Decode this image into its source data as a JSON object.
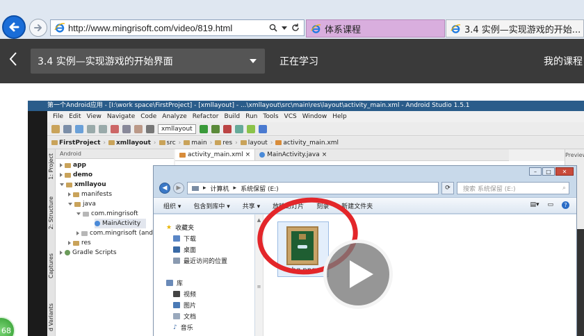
{
  "browser": {
    "url": "http://www.mingrisoft.com/video/819.html",
    "tabs": [
      {
        "label": "体系课程",
        "active": false
      },
      {
        "label": "3.4 实例—实现游戏的开始...",
        "active": true
      }
    ],
    "close_glyph": "×"
  },
  "site": {
    "course_select": "3.4  实例—实现游戏的开始界面",
    "learning_label": "正在学习",
    "my_course_label": "我的课程"
  },
  "video": {
    "as_window_title": "第一个Android应用 - [I:\\work space\\FirstProject] - [xmllayout] - ...\\xmllayout\\src\\main\\res\\layout\\activity_main.xml - Android Studio 1.5.1",
    "menu": [
      "File",
      "Edit",
      "View",
      "Navigate",
      "Code",
      "Analyze",
      "Refactor",
      "Build",
      "Run",
      "Tools",
      "VCS",
      "Window",
      "Help"
    ],
    "toolbar_combo": "xmllayout",
    "breadcrumb": [
      "FirstProject",
      "xmllayout",
      "src",
      "main",
      "res",
      "layout",
      "activity_main.xml"
    ],
    "side_tabs": [
      "1: Project",
      "2: Structure",
      "Captures",
      "d Variants"
    ],
    "project_header": "Android",
    "tree": [
      {
        "label": "app",
        "bold": true
      },
      {
        "label": "demo",
        "bold": true
      },
      {
        "label": "xmllayou",
        "bold": true
      },
      {
        "label": "manifests",
        "bold": false
      },
      {
        "label": "java",
        "bold": false
      },
      {
        "label": "com.mingrisoft",
        "bold": false
      },
      {
        "label": "MainActivity",
        "bold": false
      },
      {
        "label": "com.mingrisoft (and",
        "bold": false
      },
      {
        "label": "res",
        "bold": false
      },
      {
        "label": "Gradle Scripts",
        "bold": false
      }
    ],
    "editor_tabs": [
      "activity_main.xml",
      "MainActivity.java"
    ],
    "preview_label": "Preview",
    "explorer": {
      "path": [
        "计算机",
        "系统保留 (E:)"
      ],
      "search_placeholder": "搜索 系统保留 (E:)",
      "commands": [
        "组织 ▾",
        "包含到库中 ▾",
        "共享 ▾",
        "放映幻灯片",
        "刻录",
        "新建文件夹"
      ],
      "favorites_title": "收藏夹",
      "favorites": [
        "下载",
        "桌面",
        "最近访问的位置"
      ],
      "library_title": "库",
      "libraries": [
        "视频",
        "图片",
        "文档",
        "音乐"
      ],
      "file_name": "bg.png"
    }
  },
  "badge_text": "68",
  "colors": {
    "site_header": "#3a3a3a",
    "annotation_ring": "#e3262a",
    "tab_active": "#d9aede"
  }
}
